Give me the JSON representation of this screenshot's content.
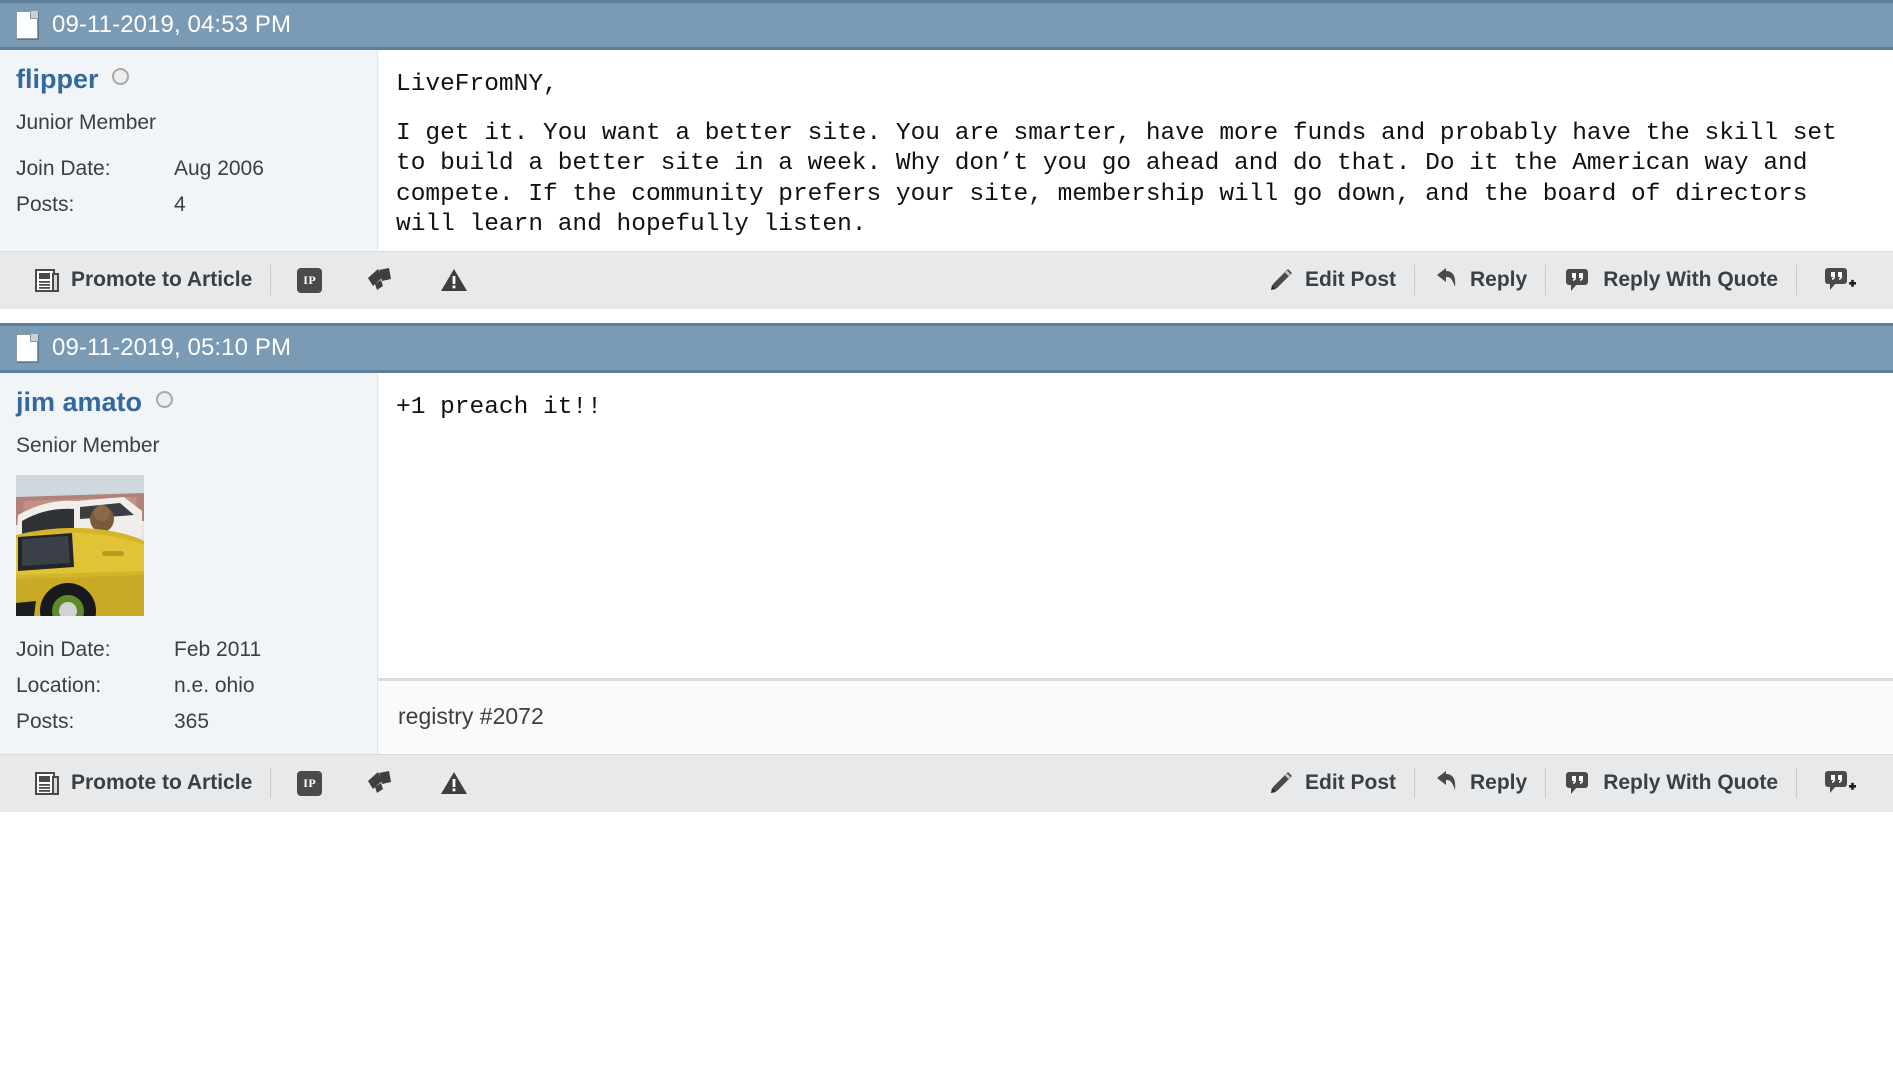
{
  "posts": [
    {
      "date": "09-11-2019, 04:53 PM",
      "user": {
        "name": "flipper",
        "title": "Junior Member",
        "stats": [
          {
            "label": "Join Date:",
            "value": "Aug 2006"
          },
          {
            "label": "Posts:",
            "value": "4"
          }
        ],
        "has_avatar": false
      },
      "message_paragraphs": [
        "LiveFromNY,",
        "I get it. You want a better site. You are smarter, have more funds and probably have the skill set to build a better site in a week. Why don’t you go ahead and do that. Do it the American way and compete. If the community prefers your site, membership will go down, and the board of directors will learn and hopefully listen."
      ],
      "signature": null
    },
    {
      "date": "09-11-2019, 05:10 PM",
      "user": {
        "name": "jim amato",
        "title": "Senior Member",
        "stats": [
          {
            "label": "Join Date:",
            "value": "Feb 2011"
          },
          {
            "label": "Location:",
            "value": "n.e. ohio"
          },
          {
            "label": "Posts:",
            "value": "365"
          }
        ],
        "has_avatar": true,
        "avatar_alt": "yellow porsche 911 targa"
      },
      "message_paragraphs": [
        "+1 preach it!!"
      ],
      "signature": "registry #2072"
    }
  ],
  "controls": {
    "promote_label": "Promote to Article",
    "ip_label": "IP",
    "edit_label": "Edit Post",
    "reply_label": "Reply",
    "reply_quote_label": "Reply With Quote",
    "icons": {
      "promote": "newspaper-icon",
      "ip": "ip-address-icon",
      "blog": "blog-this-post-icon",
      "report": "report-post-icon",
      "edit": "pencil-icon",
      "reply": "reply-arrow-icon",
      "quote": "quote-bubble-icon",
      "multiquote": "multi-quote-add-icon"
    }
  },
  "colors": {
    "header_bar": "#7b9ab4",
    "header_bar_border": "#5b7f9c",
    "sidebar_bg": "#f2f5f8",
    "username": "#33699c",
    "toolbar_bg": "#e8e9ea",
    "signature_bg": "#fbfafa",
    "text": "#3a3f44"
  },
  "icon_names": {
    "post_date": "page-icon",
    "online_status": "offline-status-dot"
  }
}
